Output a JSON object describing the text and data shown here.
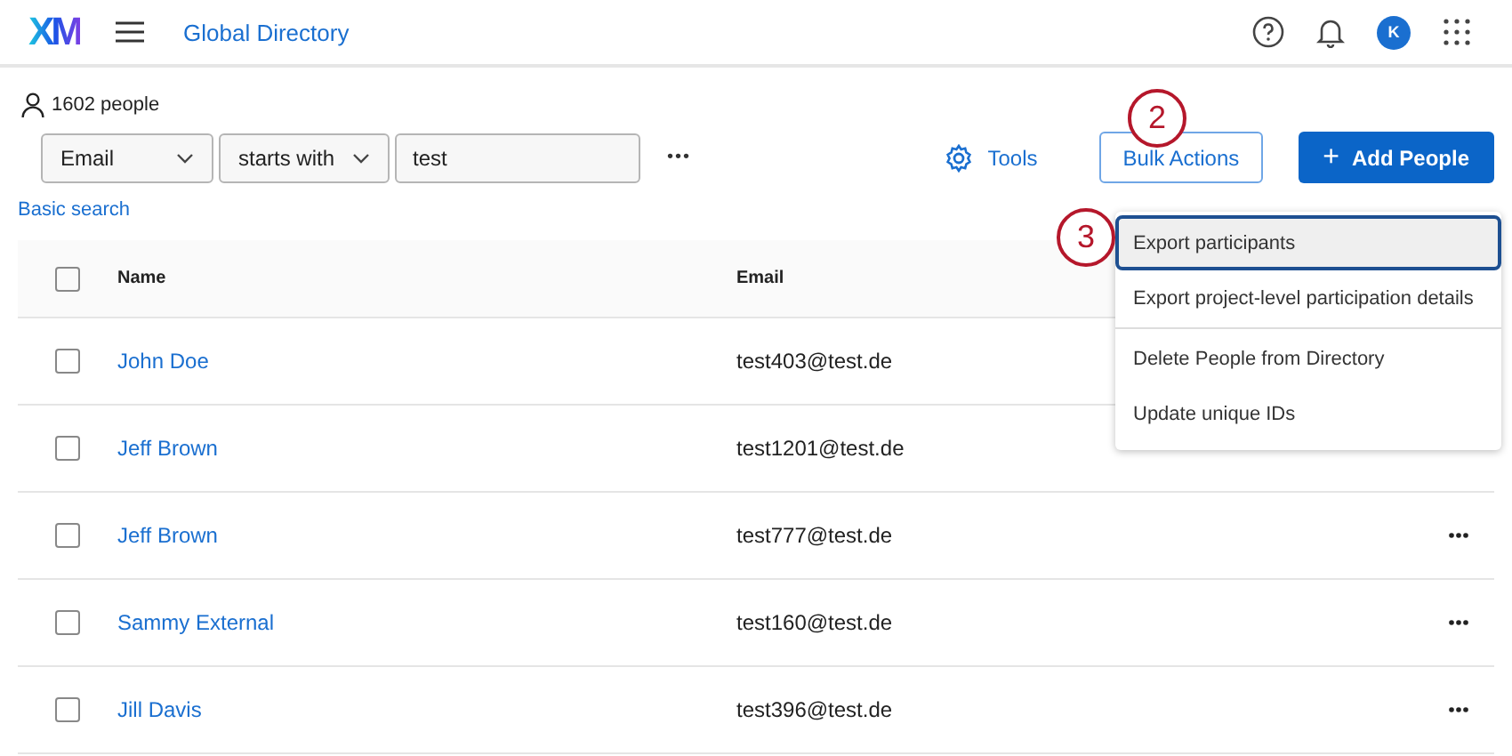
{
  "header": {
    "logo": "XM",
    "title": "Global Directory",
    "avatar": "K"
  },
  "people_count": "1602 people",
  "filter": {
    "field": "Email",
    "operator": "starts with",
    "value": "test",
    "more": "•••"
  },
  "basic_search": "Basic search",
  "actions": {
    "tools": "Tools",
    "bulk": "Bulk Actions",
    "add": "Add People",
    "add_icon": "+"
  },
  "menu": [
    {
      "label": "Export participants",
      "selected": true,
      "divider_after": false
    },
    {
      "label": "Export project-level participation details",
      "selected": false,
      "divider_after": true
    },
    {
      "label": "Delete People from Directory",
      "selected": false,
      "divider_after": false
    },
    {
      "label": "Update unique IDs",
      "selected": false,
      "divider_after": false
    }
  ],
  "callouts": [
    {
      "number": "2"
    },
    {
      "number": "3"
    }
  ],
  "table": {
    "header_checked": false,
    "columns": [
      "Name",
      "Email"
    ],
    "rows": [
      {
        "name": "John Doe",
        "email": "test403@test.de",
        "checked": false,
        "row_menu": false
      },
      {
        "name": "Jeff Brown",
        "email": "test1201@test.de",
        "checked": false,
        "row_menu": false
      },
      {
        "name": "Jeff Brown",
        "email": "test777@test.de",
        "checked": false,
        "row_menu": true
      },
      {
        "name": "Sammy External",
        "email": "test160@test.de",
        "checked": false,
        "row_menu": true
      },
      {
        "name": "Jill Davis",
        "email": "test396@test.de",
        "checked": false,
        "row_menu": true
      }
    ]
  }
}
